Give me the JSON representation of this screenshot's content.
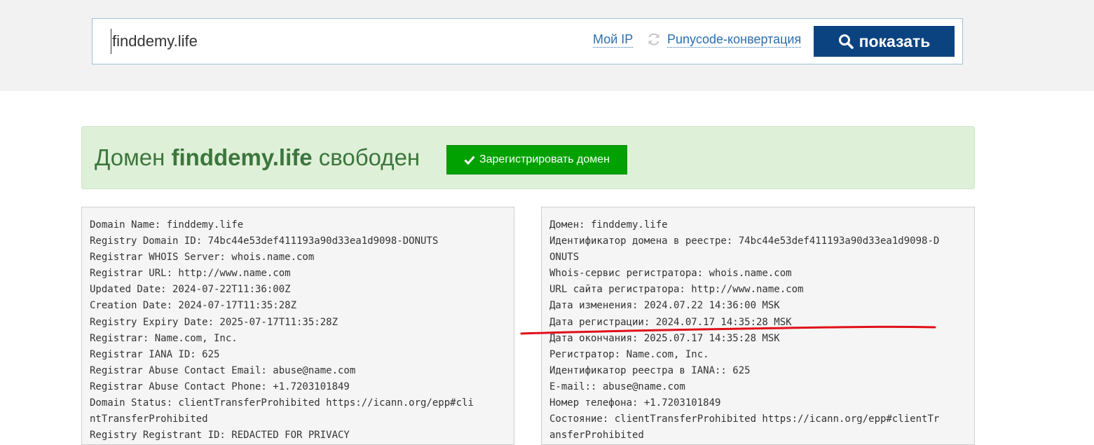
{
  "search": {
    "value": "finddemy.life",
    "my_ip_label": "Мой IP",
    "punycode_label": "Punycode-конвертация",
    "show_button_label": "показать"
  },
  "status": {
    "prefix": "Домен",
    "domain": "finddemy.life",
    "suffix": "свободен",
    "register_button_label": "Зарегистрировать домен"
  },
  "whois_raw": [
    "Domain Name: finddemy.life",
    "Registry Domain ID: 74bc44e53def411193a90d33ea1d9098-DONUTS",
    "Registrar WHOIS Server: whois.name.com",
    "Registrar URL: http://www.name.com",
    "Updated Date: 2024-07-22T11:36:00Z",
    "Creation Date: 2024-07-17T11:35:28Z",
    "Registry Expiry Date: 2025-07-17T11:35:28Z",
    "Registrar: Name.com, Inc.",
    "Registrar IANA ID: 625",
    "Registrar Abuse Contact Email: abuse@name.com",
    "Registrar Abuse Contact Phone: +1.7203101849",
    "Domain Status: clientTransferProhibited https://icann.org/epp#cli",
    "ntTransferProhibited",
    "Registry Registrant ID: REDACTED FOR PRIVACY"
  ],
  "whois_translated": [
    "Домен: finddemy.life",
    "Идентификатор домена в реестре: 74bc44e53def411193a90d33ea1d9098-D",
    "ONUTS",
    "Whois-сервис регистратора: whois.name.com",
    "URL сайта регистратора: http://www.name.com",
    "Дата изменения: 2024.07.22 14:36:00 MSK",
    "Дата регистрации: 2024.07.17 14:35:28 MSK",
    "Дата окончания: 2025.07.17 14:35:28 MSK",
    "Регистратор: Name.com, Inc.",
    "Идентификатор реестра в IANA:: 625",
    "E-mail:: abuse@name.com",
    "Номер телефона: +1.7203101849",
    "Состояние: clientTransferProhibited https://icann.org/epp#clientTr",
    "ansferProhibited"
  ],
  "colors": {
    "accent_button": "#0b4380",
    "register_button": "#00a100",
    "status_bg": "#dff0d8",
    "status_text": "#3c763d",
    "annotation_line": "#e0101a",
    "link": "#2a6fb0"
  }
}
